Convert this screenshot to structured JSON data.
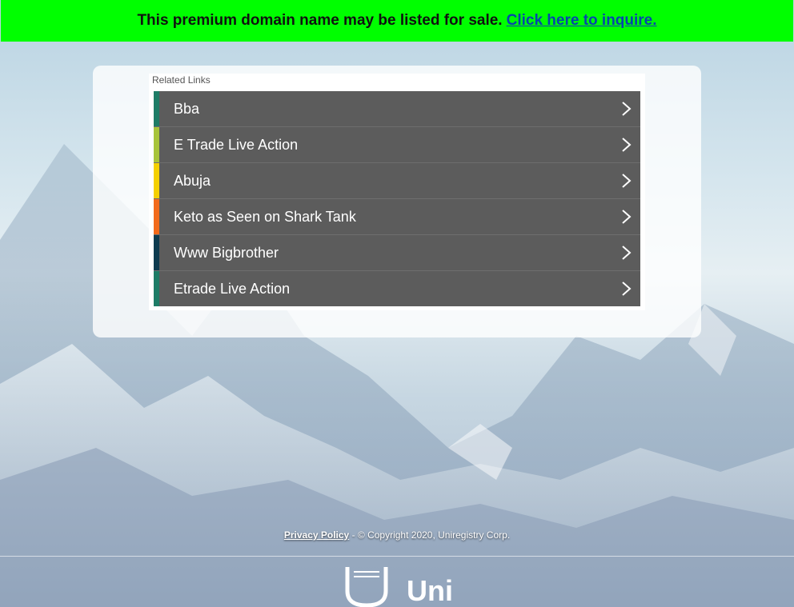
{
  "banner": {
    "text": "This premium domain name may be listed for sale.",
    "link_label": "Click here to inquire.",
    "color": "#00ff00"
  },
  "related": {
    "heading": "Related Links",
    "items": [
      {
        "label": "Bba",
        "stripe_color": "#1e7c66"
      },
      {
        "label": "E Trade Live Action",
        "stripe_color": "#a8c43a"
      },
      {
        "label": "Abuja",
        "stripe_color": "#f4d000"
      },
      {
        "label": "Keto as Seen on Shark Tank",
        "stripe_color": "#f26a1b"
      },
      {
        "label": "Www Bigbrother",
        "stripe_color": "#0e3b4f"
      },
      {
        "label": "Etrade Live Action",
        "stripe_color": "#1e7c66"
      }
    ],
    "chevron_icon": "chevron-right-icon"
  },
  "footer": {
    "privacy_label": "Privacy Policy",
    "copyright": " - © Copyright 2020, Uniregistry Corp.",
    "logo_text": "Uni"
  }
}
